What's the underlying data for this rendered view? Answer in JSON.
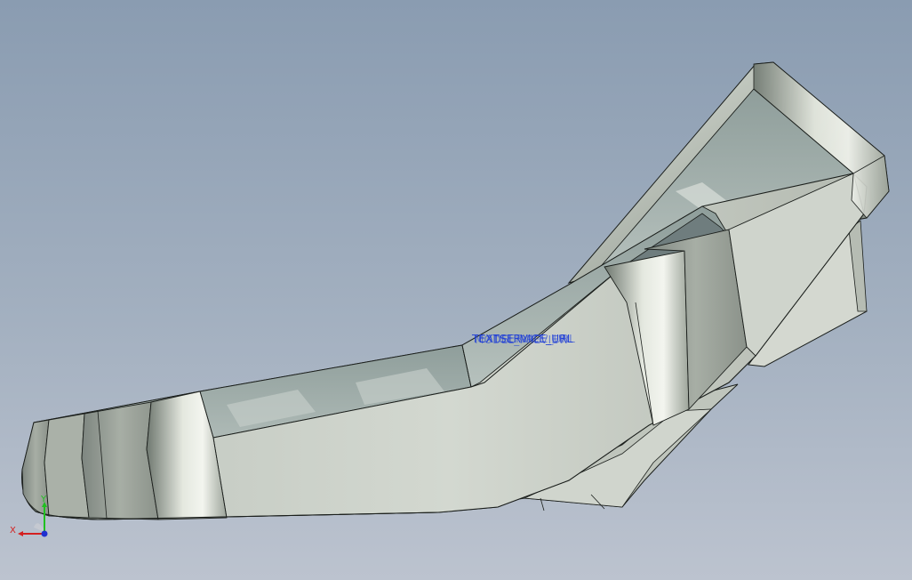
{
  "viewport": {
    "background_top": "#8a9cb1",
    "background_bottom": "#bcc3cf",
    "model_color": "#c6ccc4",
    "edge_color": "#1b1f1c"
  },
  "overlay_text": {
    "primary": "TEXTSERVICE_URL",
    "ghost_1": "MODEL_PREVIEW",
    "ghost_2": "CADSERVICE_URL",
    "color": "#1a3ad8"
  },
  "triad": {
    "x_label": "X",
    "y_label": "Y",
    "x_color": "#d42020",
    "y_color": "#20c020",
    "z_color": "#2030d0"
  }
}
